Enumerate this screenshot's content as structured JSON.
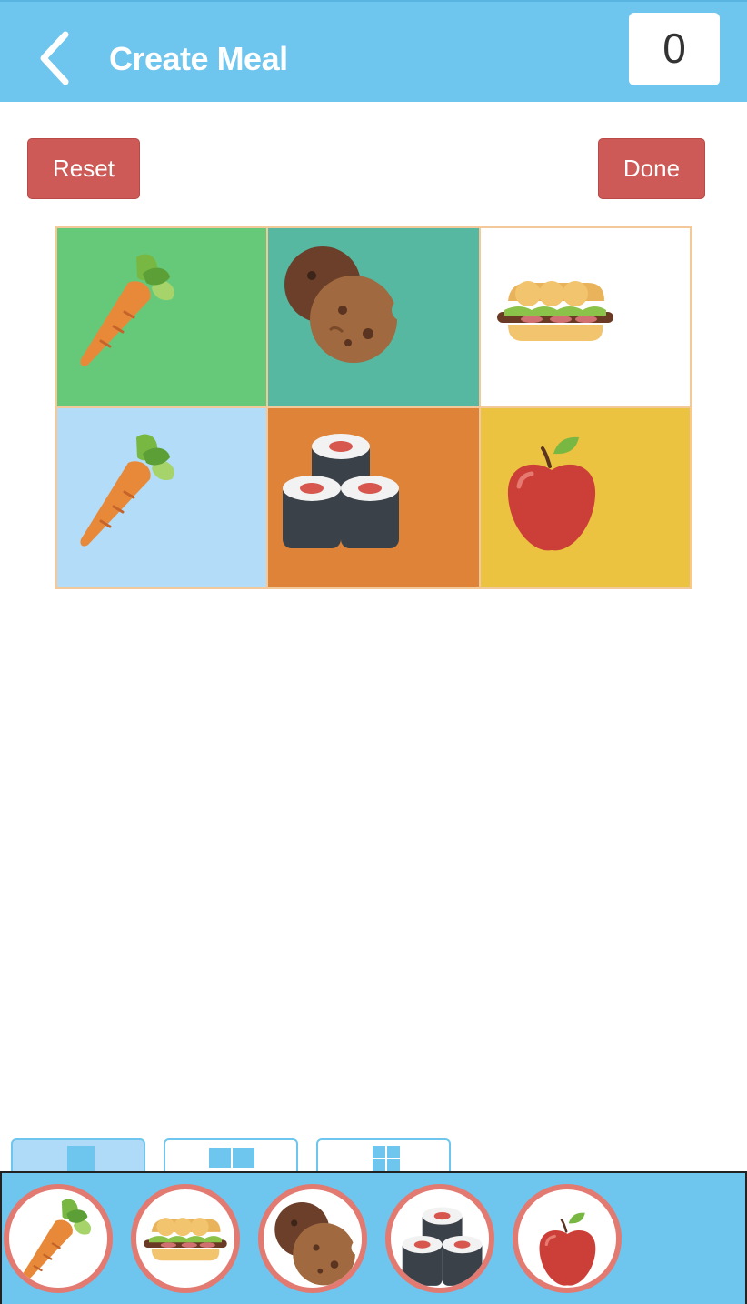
{
  "header": {
    "title": "Create Meal",
    "counter": "0",
    "back_icon": "chevron-left-icon"
  },
  "actions": {
    "reset_label": "Reset",
    "done_label": "Done"
  },
  "meal_grid": [
    {
      "item": "carrot",
      "bg": "#66c97a"
    },
    {
      "item": "cookies",
      "bg": "#56b8a0"
    },
    {
      "item": "sandwich",
      "bg": "#ffffff"
    },
    {
      "item": "carrot",
      "bg": "#b3dcf9"
    },
    {
      "item": "sushi",
      "bg": "#de8338"
    },
    {
      "item": "apple",
      "bg": "#ebc340"
    }
  ],
  "layout_tabs": [
    {
      "name": "one-column",
      "active": true
    },
    {
      "name": "two-column",
      "active": false
    },
    {
      "name": "four-grid",
      "active": false
    }
  ],
  "food_tray": [
    "carrot",
    "sandwich",
    "cookies",
    "sushi",
    "apple"
  ],
  "colors": {
    "header": "#6ec5ee",
    "button": "#cd5a56",
    "bubble_border": "#e27a72",
    "grid_border": "#f2c99a"
  }
}
